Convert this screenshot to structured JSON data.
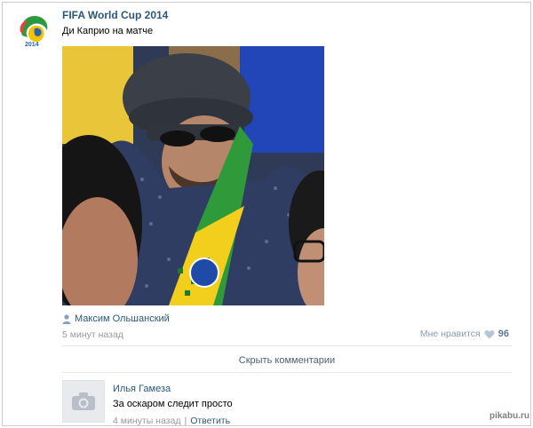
{
  "post": {
    "group_name": "FIFA World Cup 2014",
    "text": "Ди Каприо на матче",
    "author": "Максим Ольшанский",
    "time": "5 минут назад",
    "likes_label": "Мне нравится",
    "likes_count": "96"
  },
  "comments_toggle": "Скрыть комментарии",
  "comment": {
    "author": "Илья Гамеза",
    "text": "За оскаром следит просто",
    "time": "4 минуты назад",
    "separator": "|",
    "reply": "Ответить"
  },
  "watermark": "pikabu.ru",
  "icons": {
    "group_logo": "fifa-world-cup-logo",
    "author": "person-icon",
    "likes": "heart-icon",
    "comment_avatar": "camera-icon"
  },
  "colors": {
    "link": "#2b587a",
    "meta": "#999999",
    "divider": "#e4e8ee"
  }
}
